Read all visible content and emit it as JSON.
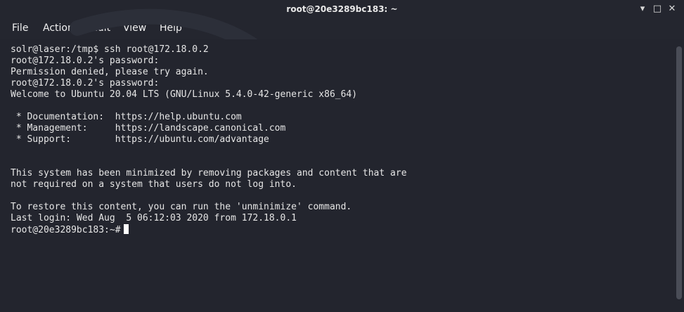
{
  "window": {
    "title": "root@20e3289bc183: ~",
    "minimize_glyph": "▾",
    "maximize_glyph": "□",
    "close_glyph": "✕"
  },
  "menu": {
    "file": "File",
    "actions": "Actions",
    "edit": "Edit",
    "view": "View",
    "help": "Help"
  },
  "terminal": {
    "lines": [
      "solr@laser:/tmp$ ssh root@172.18.0.2",
      "root@172.18.0.2's password:",
      "Permission denied, please try again.",
      "root@172.18.0.2's password:",
      "Welcome to Ubuntu 20.04 LTS (GNU/Linux 5.4.0-42-generic x86_64)",
      "",
      " * Documentation:  https://help.ubuntu.com",
      " * Management:     https://landscape.canonical.com",
      " * Support:        https://ubuntu.com/advantage",
      "",
      "",
      "This system has been minimized by removing packages and content that are",
      "not required on a system that users do not log into.",
      "",
      "To restore this content, you can run the 'unminimize' command.",
      "Last login: Wed Aug  5 06:12:03 2020 from 172.18.0.1",
      "root@20e3289bc183:~#"
    ]
  },
  "colors": {
    "background": "#23252e",
    "text": "#e6e6e6",
    "cursor": "#ffffff"
  }
}
